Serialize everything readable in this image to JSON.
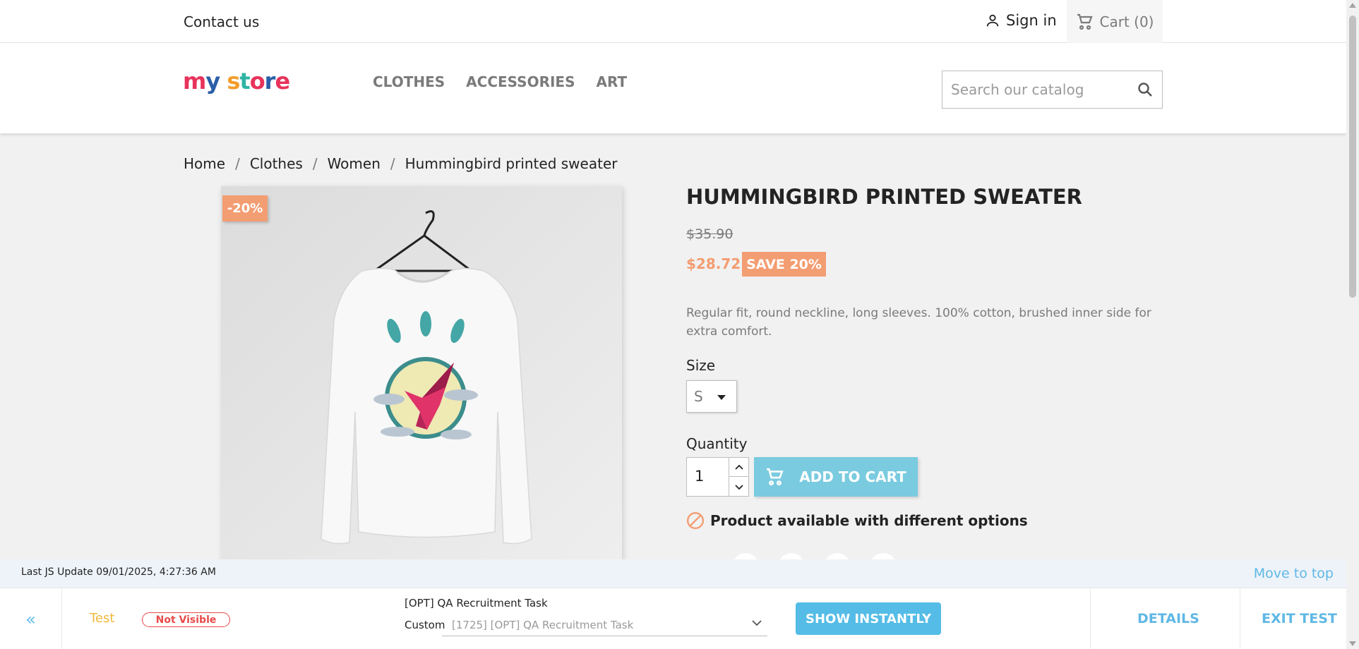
{
  "topbar": {
    "contact": "Contact us",
    "signin": "Sign in",
    "cart": "Cart (0)"
  },
  "header": {
    "logo_letters": [
      {
        "ch": "m",
        "color": "#e8335b"
      },
      {
        "ch": "y",
        "color": "#2a5fa8"
      },
      {
        "ch": " ",
        "color": "#000000"
      },
      {
        "ch": "s",
        "color": "#f39d2a"
      },
      {
        "ch": "t",
        "color": "#2fb3a4"
      },
      {
        "ch": "o",
        "color": "#e8335b"
      },
      {
        "ch": "r",
        "color": "#2a5fa8"
      },
      {
        "ch": "e",
        "color": "#e8335b"
      }
    ],
    "nav": [
      "CLOTHES",
      "ACCESSORIES",
      "ART"
    ],
    "search_placeholder": "Search our catalog"
  },
  "breadcrumb": [
    "Home",
    "Clothes",
    "Women",
    "Hummingbird printed sweater"
  ],
  "product": {
    "discount_flag": "-20%",
    "title": "HUMMINGBIRD PRINTED SWEATER",
    "old_price": "$35.90",
    "new_price": "$28.72",
    "save_badge": "SAVE 20%",
    "description": "Regular fit, round neckline, long sleeves. 100% cotton, brushed inner side for extra comfort.",
    "size_label": "Size",
    "size_value": "S",
    "quantity_label": "Quantity",
    "quantity_value": "1",
    "add_to_cart": "ADD TO CART",
    "availability": "Product available with different options"
  },
  "bottom_panel": {
    "last_update": "Last JS Update 09/01/2025, 4:27:36 AM",
    "move_to_top": "Move to top",
    "collapse_glyph": "«",
    "test_label": "Test",
    "visibility_badge": "Not Visible",
    "task_title": "[OPT] QA Recruitment Task",
    "custom_label": "Custom",
    "task_select_value": "[1725] [OPT] QA Recruitment Task",
    "show_instantly": "SHOW INSTANTLY",
    "details": "DETAILS",
    "exit_test": "EXIT TEST"
  },
  "colors": {
    "accent_blue": "#7acbdf",
    "sale_orange": "#f39d72",
    "link_blue": "#5fb8e5",
    "error_red": "#e84a4a"
  }
}
